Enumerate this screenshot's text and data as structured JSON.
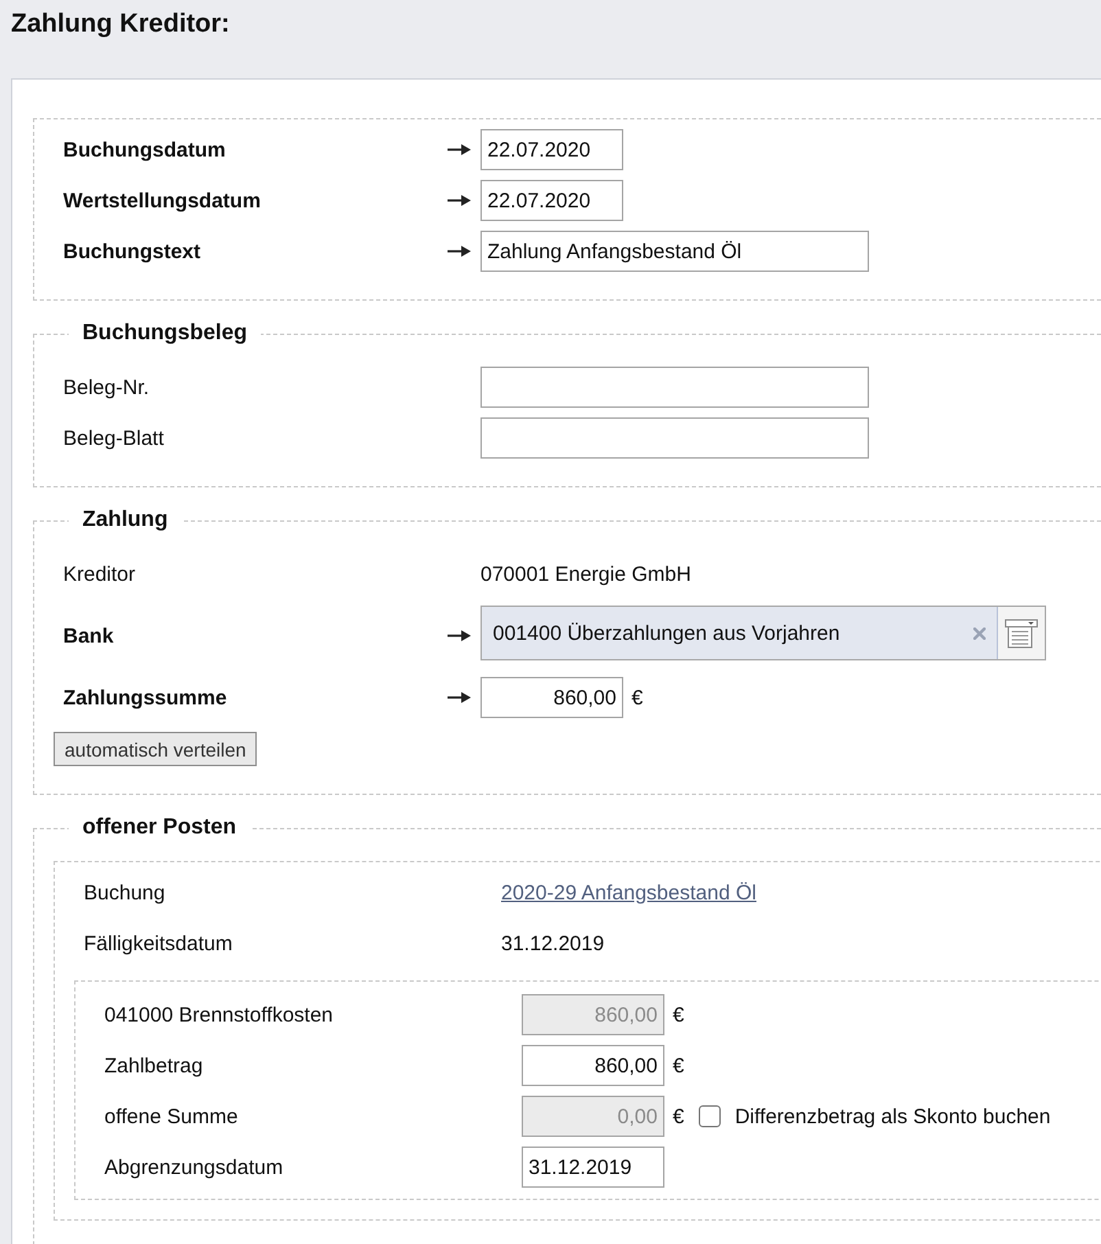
{
  "header": {
    "title": "Zahlung Kreditor:"
  },
  "sections": [
    {
      "fields": [
        {
          "label": "Buchungsdatum",
          "required": true,
          "kind": "date",
          "value": "22.07.2020"
        },
        {
          "label": "Wertstellungsdatum",
          "required": true,
          "kind": "date",
          "value": "22.07.2020"
        },
        {
          "label": "Buchungstext",
          "required": true,
          "kind": "text",
          "value": "Zahlung Anfangsbestand Öl"
        }
      ]
    },
    {
      "legend": "Buchungsbeleg",
      "fields": [
        {
          "label": "Beleg-Nr.",
          "required": false,
          "kind": "text"
        },
        {
          "label": "Beleg-Blatt",
          "required": false,
          "kind": "text"
        }
      ]
    },
    {
      "legend": "Zahlung",
      "fields": [
        {
          "label": "Kreditor",
          "required": false,
          "kind": "static",
          "value": "070001 Energie GmbH"
        },
        {
          "label": "Bank",
          "required": true,
          "kind": "combo",
          "value": "001400 Überzahlungen aus Vorjahren"
        },
        {
          "label": "Zahlungssumme",
          "required": true,
          "kind": "amount",
          "value": "860,00",
          "unit": "€",
          "disabled": false
        }
      ],
      "button": "automatisch verteilen"
    },
    {
      "legend": "offener Posten",
      "items": [
        {
          "fields": [
            {
              "label": "Buchung",
              "required": false,
              "kind": "link",
              "value": "2020-29 Anfangsbestand Öl"
            },
            {
              "label": "Fälligkeitsdatum",
              "required": false,
              "kind": "static",
              "value": "31.12.2019"
            }
          ],
          "lines": [
            {
              "label": "041000 Brennstoffkosten",
              "kind": "amount",
              "value": "860,00",
              "unit": "€",
              "disabled": true
            },
            {
              "label": "Zahlbetrag",
              "kind": "amount",
              "value": "860,00",
              "unit": "€",
              "disabled": false
            },
            {
              "label": "offene Summe",
              "kind": "amount",
              "value": "0,00",
              "unit": "€",
              "disabled": true,
              "checkbox": {
                "label": "Differenzbetrag als Skonto buchen",
                "checked": false
              }
            },
            {
              "label": "Abgrenzungsdatum",
              "kind": "date",
              "value": "31.12.2019"
            }
          ]
        }
      ]
    }
  ]
}
